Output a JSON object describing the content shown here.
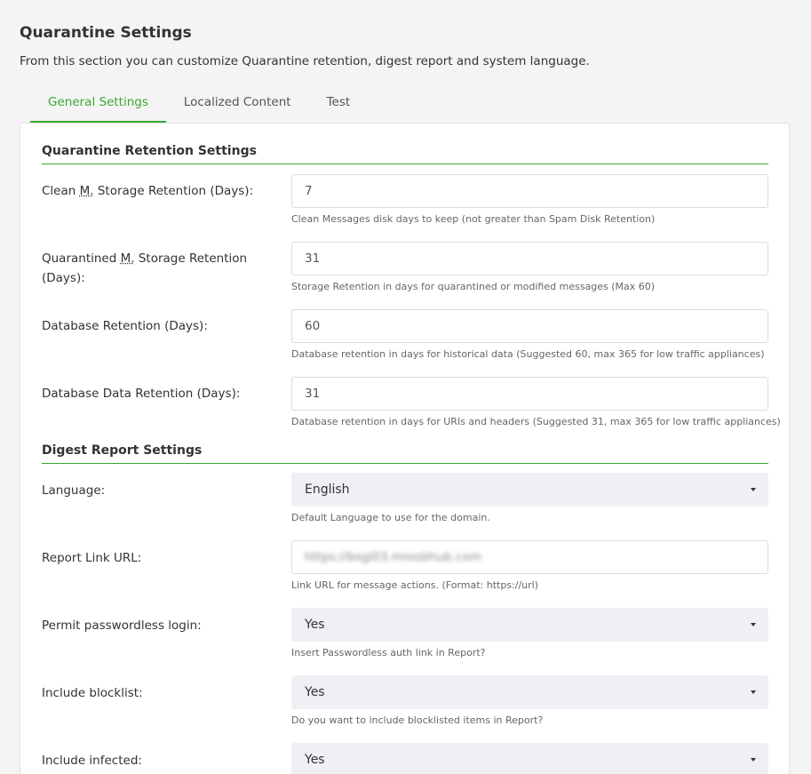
{
  "header": {
    "title": "Quarantine Settings",
    "description": "From this section you can customize Quarantine retention, digest report and system language."
  },
  "tabs": [
    {
      "label": "General Settings",
      "active": true
    },
    {
      "label": "Localized Content",
      "active": false
    },
    {
      "label": "Test",
      "active": false
    }
  ],
  "retention": {
    "section_title": "Quarantine Retention Settings",
    "clean": {
      "label_pre": "Clean ",
      "label_abbr": "M.",
      "label_post": " Storage Retention (Days):",
      "value": "7",
      "help": "Clean Messages disk days to keep (not greater than Spam Disk Retention)"
    },
    "quarantined": {
      "label_pre": "Quarantined ",
      "label_abbr": "M.",
      "label_post": " Storage Retention (Days):",
      "value": "31",
      "help": "Storage Retention in days for quarantined or modified messages (Max 60)"
    },
    "database": {
      "label": "Database Retention (Days):",
      "value": "60",
      "help": "Database retention in days for historical data (Suggested 60, max 365 for low traffic appliances)"
    },
    "database_data": {
      "label": "Database Data Retention (Days):",
      "value": "31",
      "help": "Database retention in days for URIs and headers (Suggested 31, max 365 for low traffic appliances)"
    }
  },
  "digest": {
    "section_title": "Digest Report Settings",
    "language": {
      "label": "Language:",
      "value": "English",
      "help": "Default Language to use for the domain."
    },
    "report_link": {
      "label": "Report Link URL:",
      "value": "https://bsgl03.mrosbhub.com",
      "help": "Link URL for message actions. (Format: https://url)"
    },
    "passwordless": {
      "label": "Permit passwordless login:",
      "value": "Yes",
      "help": "Insert Passwordless auth link in Report?"
    },
    "blocklist": {
      "label": "Include blocklist:",
      "value": "Yes",
      "help": "Do you want to include blocklisted items in Report?"
    },
    "infected": {
      "label": "Include infected:",
      "value": "Yes"
    }
  },
  "colors": {
    "accent": "#3aa832",
    "select_bg": "#eef0f4"
  }
}
